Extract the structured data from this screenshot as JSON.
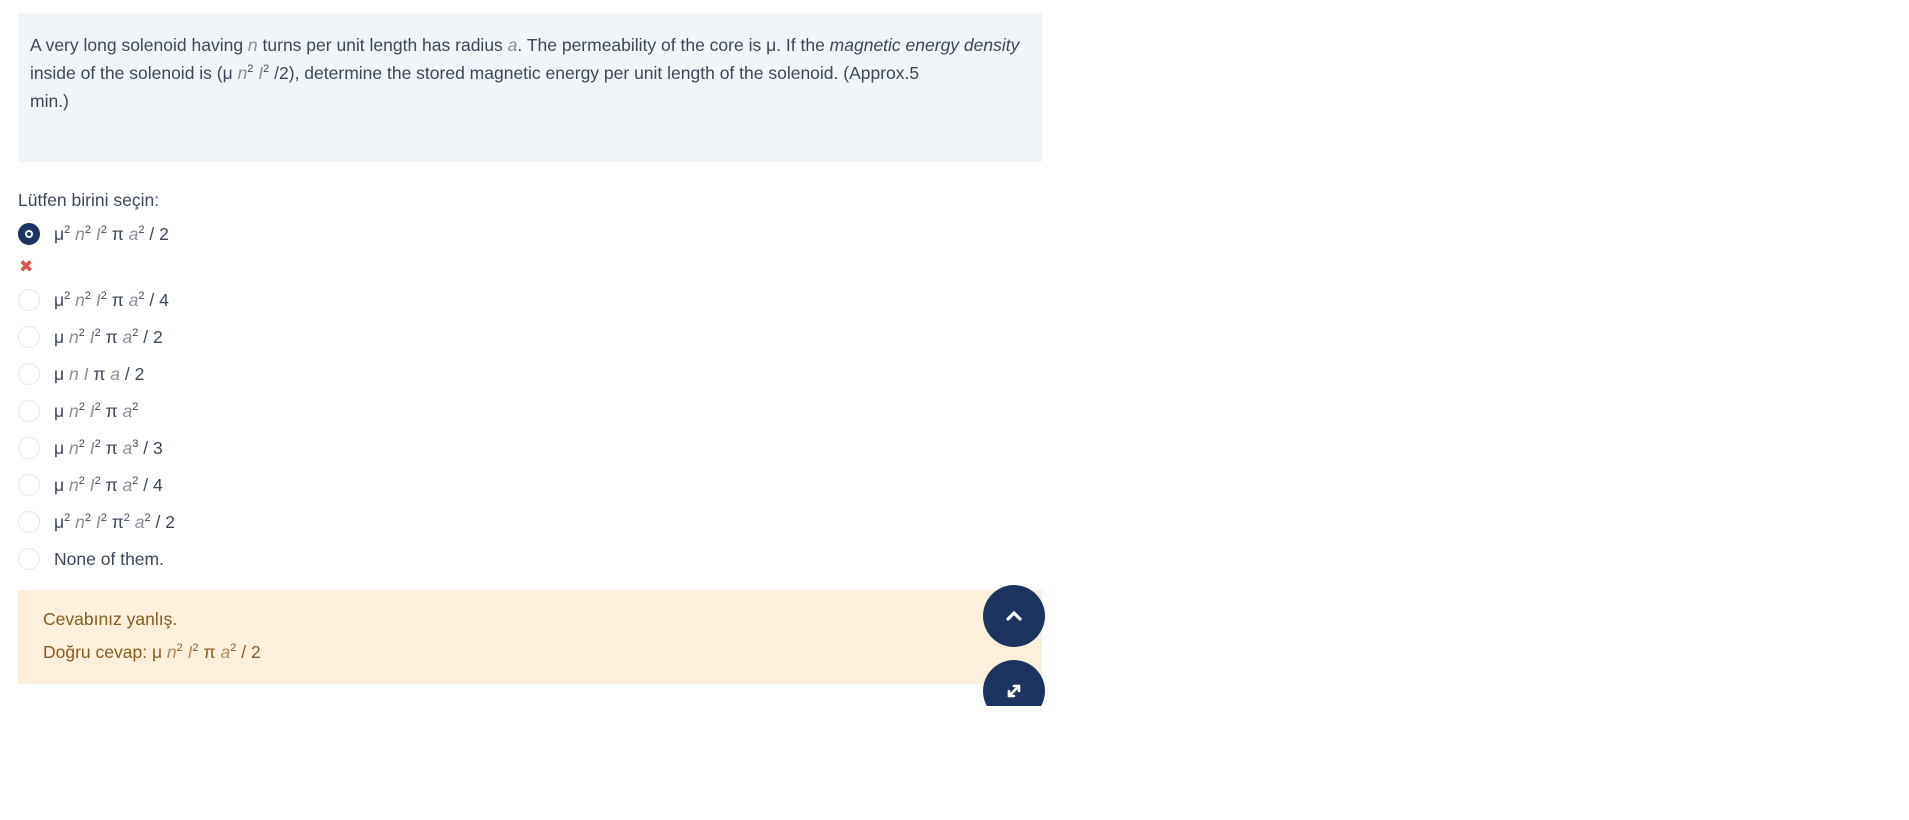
{
  "question": {
    "text_1": "A very long solenoid having ",
    "var_n": "n",
    "text_2": " turns per unit length has radius ",
    "var_a": "a",
    "text_3": ". The permeability of the core is μ.  If the ",
    "em_text": "magnetic energy density",
    "text_4": "inside of the solenoid is (μ ",
    "var_n2": "n",
    "sup_2a": "2",
    "var_I": "I",
    "sup_2b": "2",
    "text_5": " /2), determine the stored magnetic energy per unit length of the solenoid. (Approx.5",
    "text_6": "min.)"
  },
  "prompt": "Lütfen birini seçin:",
  "selected_index": 0,
  "wrong_mark": "✖",
  "options": [
    {
      "label": "μ2 n2 I2 π a2 / 2"
    },
    {
      "label": "μ2 n2 I2 π a2 / 4"
    },
    {
      "label": "μ n2 I2 π a2 / 2"
    },
    {
      "label": "μ n I π a / 2"
    },
    {
      "label": "μ n2 I2 π a2"
    },
    {
      "label": "μ n2 I2 π a3 / 3"
    },
    {
      "label": "μ n2 I2 π a2 / 4"
    },
    {
      "label": "μ2 n2 I2 π2 a2 / 2"
    },
    {
      "label": "None of them."
    }
  ],
  "feedback": {
    "status": "Cevabınız yanlış.",
    "correct_prefix": "Doğru cevap: ",
    "correct_answer": "μ n2 I2 π a2 / 2"
  },
  "colors": {
    "accent": "#1d3461",
    "question_bg": "#f1f5f9",
    "feedback_bg": "#fcefdc",
    "feedback_text": "#8a5a1c",
    "wrong": "#d9534f"
  },
  "icons": {
    "scroll_up": "chevron-up-icon",
    "expand": "expand-icon",
    "incorrect": "cross-icon"
  }
}
